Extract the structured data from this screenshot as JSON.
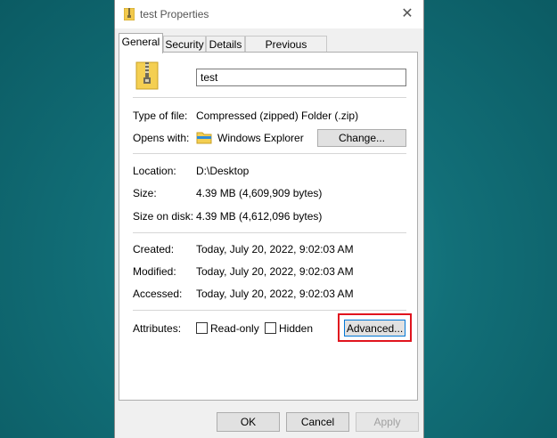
{
  "window": {
    "title": "test Properties"
  },
  "tabs": [
    "General",
    "Security",
    "Details",
    "Previous Versions"
  ],
  "general": {
    "file_name": "test",
    "type_label": "Type of file:",
    "type_value": "Compressed (zipped) Folder (.zip)",
    "opens_label": "Opens with:",
    "opens_value": "Windows Explorer",
    "change_label": "Change...",
    "location_label": "Location:",
    "location_value": "D:\\Desktop",
    "size_label": "Size:",
    "size_value": "4.39 MB (4,609,909 bytes)",
    "size_on_disk_label": "Size on disk:",
    "size_on_disk_value": "4.39 MB (4,612,096 bytes)",
    "created_label": "Created:",
    "created_value": "Today, July 20, 2022, 9:02:03 AM",
    "modified_label": "Modified:",
    "modified_value": "Today, July 20, 2022, 9:02:03 AM",
    "accessed_label": "Accessed:",
    "accessed_value": "Today, July 20, 2022, 9:02:03 AM",
    "attributes_label": "Attributes:",
    "readonly_label": "Read-only",
    "hidden_label": "Hidden",
    "advanced_label": "Advanced..."
  },
  "footer": {
    "ok": "OK",
    "cancel": "Cancel",
    "apply": "Apply"
  },
  "colors": {
    "highlight": "#e0141e",
    "desktop": "#126f78",
    "focus": "#0078d7"
  }
}
